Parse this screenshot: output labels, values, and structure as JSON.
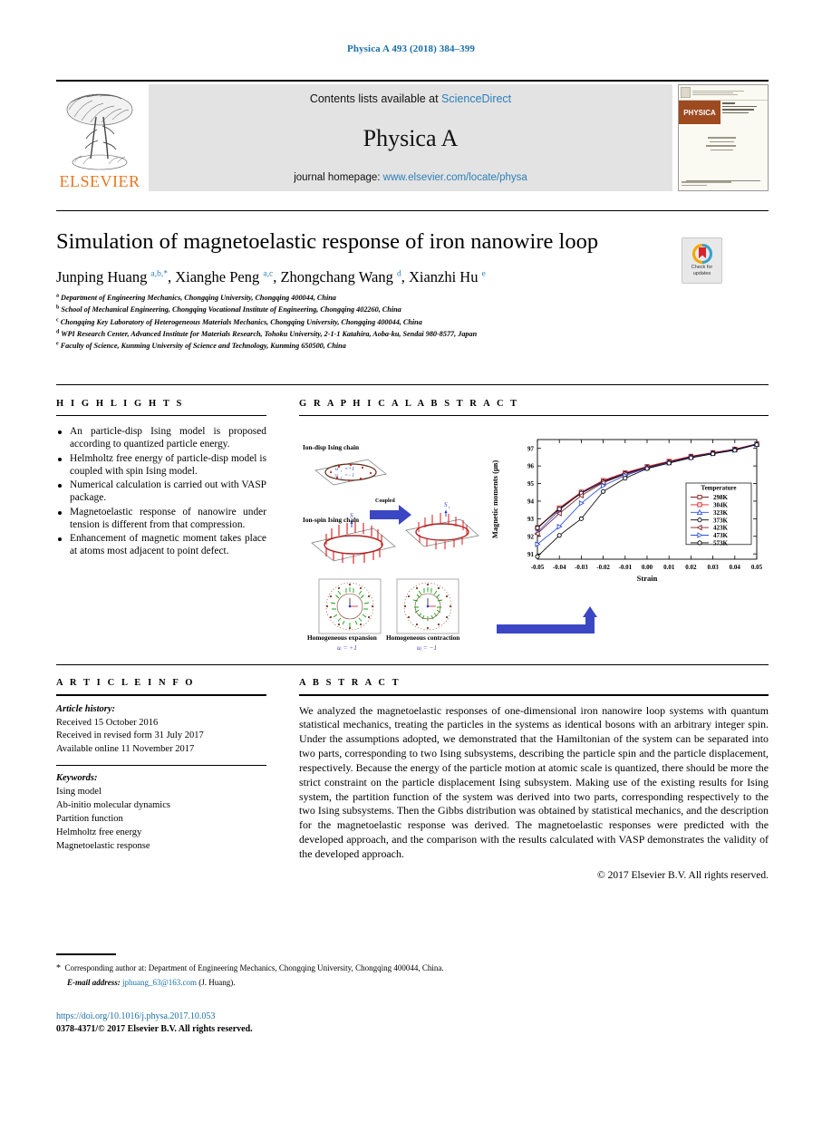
{
  "running_head": "Physica A 493 (2018) 384–399",
  "masthead": {
    "contents_prefix": "Contents lists available at ",
    "sciencedirect": "ScienceDirect",
    "journal_name": "Physica A",
    "homepage_prefix": "journal homepage: ",
    "homepage_url": "www.elsevier.com/locate/physa",
    "publisher": "ELSEVIER",
    "cover_band_text": "PHYSICA"
  },
  "title": "Simulation of magnetoelastic response of iron nanowire loop",
  "check_updates": {
    "line1": "Check for",
    "line2": "updates"
  },
  "authors_html": "Junping Huang <sup>a,b,</sup><sup>*</sup>, Xianghe Peng <sup>a,c</sup>, Zhongchang Wang <sup>d</sup>, Xianzhi Hu <sup>e</sup>",
  "affiliations": [
    {
      "tag": "a",
      "text": "Department of Engineering Mechanics, Chongqing University, Chongqing 400044, China"
    },
    {
      "tag": "b",
      "text": "School of Mechanical Engineering, Chongqing Vocational Institute of Engineering, Chongqing 402260, China"
    },
    {
      "tag": "c",
      "text": "Chongqing Key Laboratory of Heterogeneous Materials Mechanics, Chongqing University, Chongqing 400044, China"
    },
    {
      "tag": "d",
      "text": "WPI Research Center, Advanced Institute for Materials Research, Tohoku University, 2-1-1 Katahira, Aoba-ku, Sendai 980-8577, Japan"
    },
    {
      "tag": "e",
      "text": "Faculty of Science, Kunming University of Science and Technology, Kunming 650500, China"
    }
  ],
  "highlights": {
    "heading": "H I G H L I G H T S",
    "items": [
      "An particle-disp Ising model is proposed according to quantized particle energy.",
      "Helmholtz free energy of particle-disp model is coupled with spin Ising model.",
      "Numerical calculation is carried out with VASP package.",
      "Magnetoelastic response of nanowire under tension is different from that compression.",
      "Enhancement of magnetic moment takes place at atoms most adjacent to point defect."
    ]
  },
  "graphical_abstract": {
    "heading": "G R A P H I C A L   A B S T R A C T",
    "diagram_labels": {
      "ion_disp": "Ion-disp Ising chain",
      "ion_spin": "Ion-spin Ising chain",
      "coupled": "Coupled",
      "expansion": "Homogeneous expansion",
      "expansion_sub": "uᵢ = +1",
      "contraction": "Homogeneous contraction",
      "contraction_sub": "uⱼ = −1"
    }
  },
  "chart_data": {
    "type": "line",
    "title": "",
    "xlabel": "Strain",
    "ylabel": "Magnetic moments (μʙ)",
    "xlim": [
      -0.05,
      0.05
    ],
    "ylim": [
      90.7,
      97.5
    ],
    "xticks": [
      -0.05,
      -0.04,
      -0.03,
      -0.02,
      -0.01,
      0.0,
      0.01,
      0.02,
      0.03,
      0.04,
      0.05
    ],
    "xtick_labels": [
      "-0.05",
      "-0.04",
      "-0.03",
      "-0.02",
      "-0.01",
      "0.00",
      "0.01",
      "0.02",
      "0.03",
      "0.04",
      "0.05"
    ],
    "yticks": [
      91,
      92,
      93,
      94,
      95,
      96,
      97
    ],
    "ytick_labels": [
      "91",
      "92",
      "93",
      "94",
      "95",
      "96",
      "97"
    ],
    "grid": false,
    "legend_title": "Temperature",
    "legend_position": "lower-right",
    "x": [
      -0.05,
      -0.04,
      -0.03,
      -0.02,
      -0.01,
      0.0,
      0.01,
      0.02,
      0.03,
      0.04,
      0.05
    ],
    "series": [
      {
        "name": "298K",
        "color": "#7a2020",
        "marker": "square",
        "values": [
          92.5,
          93.6,
          94.5,
          95.15,
          95.6,
          95.95,
          96.25,
          96.55,
          96.75,
          96.95,
          97.25
        ]
      },
      {
        "name": "304K",
        "color": "#e01b1b",
        "marker": "square",
        "values": [
          92.45,
          93.62,
          94.52,
          95.18,
          95.62,
          95.97,
          96.27,
          96.55,
          96.76,
          96.96,
          97.26
        ]
      },
      {
        "name": "323K",
        "color": "#2b4fe0",
        "marker": "triangle",
        "values": [
          92.22,
          93.5,
          94.48,
          95.12,
          95.58,
          95.92,
          96.22,
          96.52,
          96.74,
          96.94,
          97.24
        ]
      },
      {
        "name": "373K",
        "color": "#000000",
        "marker": "circle",
        "values": [
          92.48,
          93.55,
          94.45,
          95.1,
          95.56,
          95.92,
          96.22,
          96.52,
          96.73,
          96.93,
          97.24
        ]
      },
      {
        "name": "423K",
        "color": "#7a2020",
        "marker": "left-triangle",
        "values": [
          92.15,
          93.3,
          94.32,
          95.05,
          95.52,
          95.9,
          96.2,
          96.5,
          96.72,
          96.92,
          97.23
        ]
      },
      {
        "name": "473K",
        "color": "#2b4fe0",
        "marker": "right-triangle",
        "values": [
          91.55,
          92.55,
          93.88,
          94.88,
          95.45,
          95.88,
          96.18,
          96.48,
          96.7,
          96.9,
          97.22
        ]
      },
      {
        "name": "573K",
        "color": "#000000",
        "marker": "circle",
        "values": [
          90.85,
          92.05,
          93.0,
          94.55,
          95.3,
          95.85,
          96.16,
          96.46,
          96.69,
          96.89,
          97.21
        ]
      }
    ]
  },
  "article_info": {
    "heading": "A R T I C L E   I N F O",
    "history_label": "Article history:",
    "history": [
      "Received 15 October 2016",
      "Received in revised form 31 July 2017",
      "Available online 11 November 2017"
    ],
    "keywords_label": "Keywords:",
    "keywords": [
      "Ising model",
      "Ab-initio molecular dynamics",
      "Partition function",
      "Helmholtz free energy",
      "Magnetoelastic response"
    ]
  },
  "abstract": {
    "heading": "A B S T R A C T",
    "text": "We analyzed the magnetoelastic responses of one-dimensional iron nanowire loop systems with quantum statistical mechanics, treating the particles in the systems as identical bosons with an arbitrary integer spin. Under the assumptions adopted, we demonstrated that the Hamiltonian of the system can be separated into two parts, corresponding to two Ising subsystems, describing the particle spin and the particle displacement, respectively. Because the energy of the particle motion at atomic scale is quantized, there should be more the strict constraint on the particle displacement Ising subsystem. Making use of the existing results for Ising system, the partition function of the system was derived into two parts, corresponding respectively to the two Ising subsystems. Then the Gibbs distribution was obtained by statistical mechanics, and the description for the magnetoelastic response was derived. The magnetoelastic responses were predicted with the developed approach, and the comparison with the results calculated with VASP demonstrates the validity of the developed approach.",
    "copyright": "© 2017 Elsevier B.V. All rights reserved."
  },
  "footer": {
    "corresponding": "Corresponding author at: Department of Engineering Mechanics, Chongqing University, Chongqing 400044, China.",
    "email_label": "E-mail address:",
    "email": "jphuang_63@163.com",
    "email_suffix": "(J. Huang).",
    "doi": "https://doi.org/10.1016/j.physa.2017.10.053",
    "issn": "0378-4371/© 2017 Elsevier B.V. All rights reserved."
  },
  "colors": {
    "link": "#1a6ea8",
    "elsevier_orange": "#E87722",
    "arrow_blue": "#3b46c4"
  }
}
